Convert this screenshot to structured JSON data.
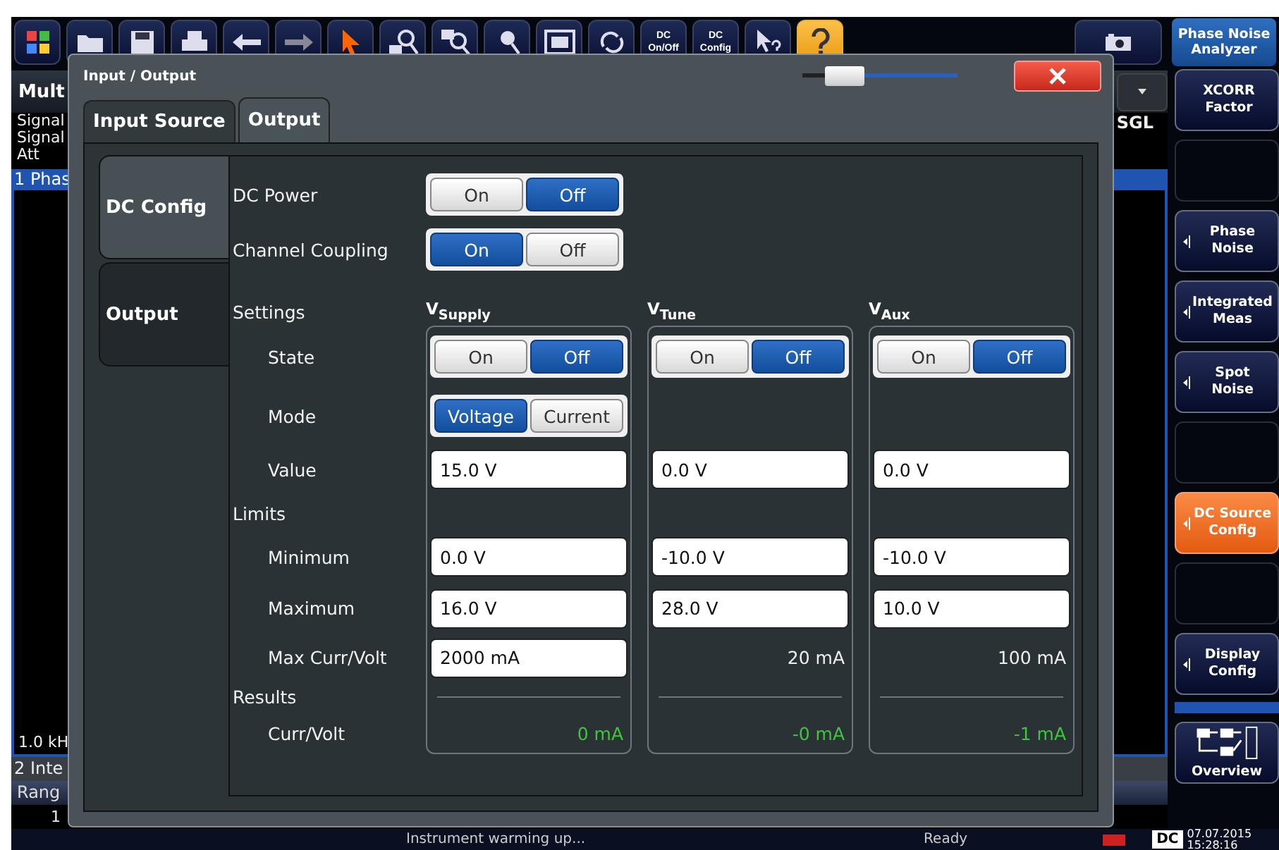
{
  "toolbar": {
    "text_buttons": [
      {
        "top": "DC",
        "bottom": "On/Off"
      },
      {
        "top": "DC",
        "bottom": "Config"
      }
    ]
  },
  "background": {
    "view_tab": "Mult",
    "info_lines": [
      "Signal",
      "Signal",
      "Att"
    ],
    "sweep_mode": "SGL",
    "window_title": "1 Phas",
    "x_axis_start": "1.0 kH",
    "second_window_title": "2 Inte",
    "table_header": "Rang",
    "table_cell": "1"
  },
  "softkeys": {
    "title": [
      "Phase Noise",
      "Analyzer"
    ],
    "keys": [
      {
        "kind": "key",
        "lines": [
          "XCORR",
          "Factor"
        ],
        "submenu": false,
        "selected": false
      },
      {
        "kind": "blank"
      },
      {
        "kind": "key",
        "lines": [
          "Phase",
          "Noise"
        ],
        "submenu": true,
        "selected": false
      },
      {
        "kind": "key",
        "lines": [
          "Integrated",
          "Meas"
        ],
        "submenu": true,
        "selected": false
      },
      {
        "kind": "key",
        "lines": [
          "Spot",
          "Noise"
        ],
        "submenu": true,
        "selected": false
      },
      {
        "kind": "blank"
      },
      {
        "kind": "key",
        "lines": [
          "DC Source",
          "Config"
        ],
        "submenu": true,
        "selected": true
      },
      {
        "kind": "blank"
      },
      {
        "kind": "key",
        "lines": [
          "Display",
          "Config"
        ],
        "submenu": true,
        "selected": false
      }
    ],
    "overview": "Overview"
  },
  "dialog": {
    "title": "Input / Output",
    "transparency": {
      "level": 0.2
    },
    "tabs": [
      {
        "label": "Input Source",
        "selected": false
      },
      {
        "label": "Output",
        "selected": true
      }
    ],
    "side_tabs": [
      {
        "label": "DC Config",
        "selected": true
      },
      {
        "label": "Output",
        "selected": false
      }
    ],
    "switches": [
      {
        "label": "DC Power",
        "options": [
          {
            "label": "On",
            "selected": false
          },
          {
            "label": "Off",
            "selected": true
          }
        ]
      },
      {
        "label": "Channel Coupling",
        "options": [
          {
            "label": "On",
            "selected": true
          },
          {
            "label": "Off",
            "selected": false
          }
        ]
      }
    ],
    "settings_label": "Settings",
    "channels": [
      "V$_{Supply}$",
      "V$_{Tune}$",
      "V$_{Aux}$"
    ],
    "rows": [
      {
        "kind": "setting",
        "label": "State",
        "cells": [
          {
            "kind": "toggle",
            "options": [
              {
                "label": "On",
                "selected": false
              },
              {
                "label": "Off",
                "selected": true
              }
            ]
          },
          {
            "kind": "toggle",
            "options": [
              {
                "label": "On",
                "selected": false
              },
              {
                "label": "Off",
                "selected": true
              }
            ]
          },
          {
            "kind": "toggle",
            "options": [
              {
                "label": "On",
                "selected": false
              },
              {
                "label": "Off",
                "selected": true
              }
            ]
          }
        ]
      },
      {
        "kind": "setting",
        "label": "Mode",
        "cells": [
          {
            "kind": "toggle",
            "options": [
              {
                "label": "Voltage",
                "selected": true
              },
              {
                "label": "Current",
                "selected": false
              }
            ]
          },
          null,
          null
        ]
      },
      {
        "kind": "setting",
        "label": "Value",
        "cells": [
          {
            "kind": "field",
            "value": "15.0 V"
          },
          {
            "kind": "field",
            "value": "0.0 V"
          },
          {
            "kind": "field",
            "value": "0.0 V"
          }
        ]
      },
      {
        "kind": "heading",
        "label": "Limits"
      },
      {
        "kind": "setting",
        "label": "Minimum",
        "cells": [
          {
            "kind": "field",
            "value": "0.0 V"
          },
          {
            "kind": "field",
            "value": "-10.0 V"
          },
          {
            "kind": "field",
            "value": "-10.0 V"
          }
        ]
      },
      {
        "kind": "setting",
        "label": "Maximum",
        "cells": [
          {
            "kind": "field",
            "value": "16.0 V"
          },
          {
            "kind": "field",
            "value": "28.0 V"
          },
          {
            "kind": "field",
            "value": "10.0 V"
          }
        ]
      },
      {
        "kind": "setting",
        "label": "Max Curr/Volt",
        "cells": [
          {
            "kind": "field",
            "value": "2000 mA"
          },
          {
            "kind": "text",
            "text": "20 mA"
          },
          {
            "kind": "text",
            "text": "100 mA"
          }
        ]
      },
      {
        "kind": "heading",
        "label": "Results"
      },
      {
        "kind": "setting",
        "label": "Curr/Volt",
        "cells": [
          {
            "kind": "result",
            "text": "0 mA"
          },
          {
            "kind": "result",
            "text": "-0 mA"
          },
          {
            "kind": "result",
            "text": "-1 mA"
          }
        ]
      }
    ]
  },
  "status_bar": {
    "message": "Instrument warming up...",
    "state": "Ready",
    "dc_label": "DC",
    "date": "07.07.2015",
    "time": "15:28:16"
  }
}
